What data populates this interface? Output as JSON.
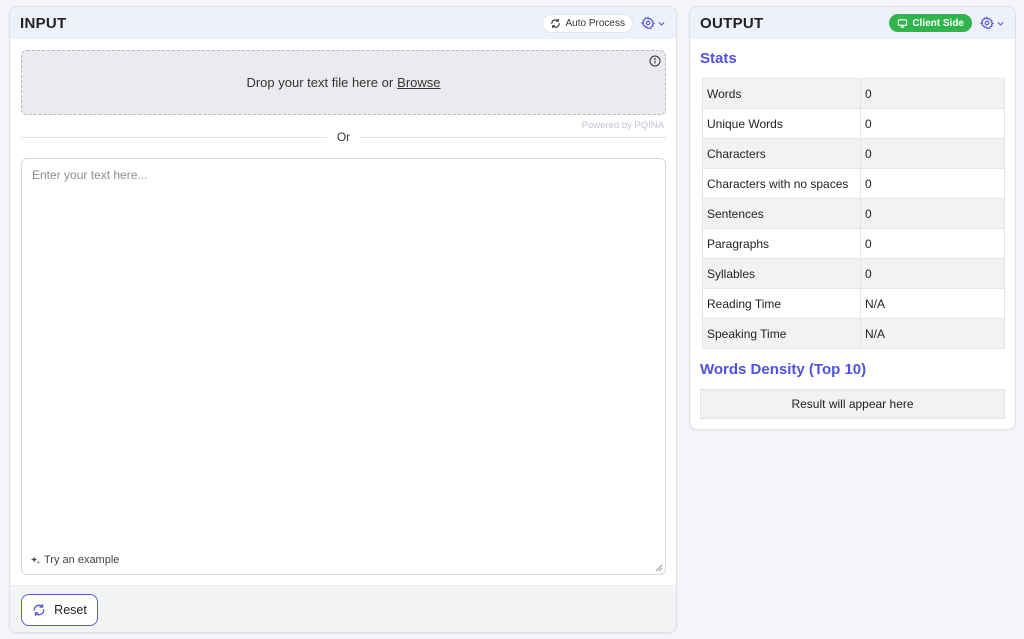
{
  "input": {
    "title": "INPUT",
    "auto_process_label": "Auto Process",
    "dropzone_text": "Drop your text file here or",
    "browse_label": "Browse",
    "powered_by": "Powered by PQINA",
    "or_text": "Or",
    "textarea_placeholder": "Enter your text here...",
    "textarea_value": "",
    "try_example_label": "Try an example",
    "reset_label": "Reset"
  },
  "output": {
    "title": "OUTPUT",
    "client_side_label": "Client Side",
    "stats_title": "Stats",
    "stats": [
      {
        "label": "Words",
        "value": "0"
      },
      {
        "label": "Unique Words",
        "value": "0"
      },
      {
        "label": "Characters",
        "value": "0"
      },
      {
        "label": "Characters with no spaces",
        "value": "0"
      },
      {
        "label": "Sentences",
        "value": "0"
      },
      {
        "label": "Paragraphs",
        "value": "0"
      },
      {
        "label": "Syllables",
        "value": "0"
      },
      {
        "label": "Reading Time",
        "value": "N/A"
      },
      {
        "label": "Speaking Time",
        "value": "N/A"
      }
    ],
    "density_title": "Words Density (Top 10)",
    "result_placeholder": "Result will appear here"
  },
  "colors": {
    "accent": "#5b5bd6",
    "section_title": "#4f52e0",
    "client_side_badge": "#2fb54a",
    "header_bg": "#eef0fb"
  },
  "icons": [
    "refresh-icon",
    "gear-icon",
    "chevron-down-icon",
    "monitor-icon",
    "info-icon",
    "sparkle-icon",
    "reset-icon",
    "resize-grip-icon"
  ]
}
